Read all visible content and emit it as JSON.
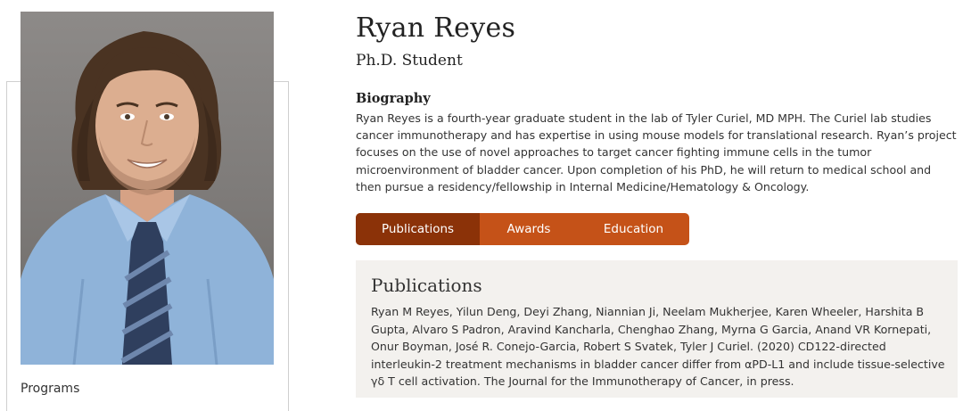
{
  "profile": {
    "name": "Ryan Reyes",
    "title": "Ph.D. Student"
  },
  "sidebar": {
    "programs_label": "Programs"
  },
  "biography": {
    "heading": "Biography",
    "text": "Ryan Reyes is a fourth-year graduate student in the lab of Tyler Curiel, MD MPH. The Curiel lab studies cancer immunotherapy and has expertise in using mouse models for translational research. Ryan’s project focuses on the use of novel approaches to target cancer fighting immune cells in the tumor microenvironment of bladder cancer. Upon completion of his PhD, he will return to medical school and then pursue a residency/fellowship in Internal Medicine/Hematology & Oncology."
  },
  "tabs": [
    {
      "label": "Publications",
      "active": true
    },
    {
      "label": "Awards",
      "active": false
    },
    {
      "label": "Education",
      "active": false
    }
  ],
  "publications": {
    "heading": "Publications",
    "entry": "Ryan M Reyes, Yilun Deng, Deyi Zhang, Niannian Ji, Neelam Mukherjee, Karen Wheeler, Harshita B Gupta, Alvaro S Padron, Aravind Kancharla, Chenghao Zhang, Myrna G Garcia, Anand VR Kornepati, Onur Boyman, José R. Conejo-Garcia, Robert S Svatek, Tyler J Curiel. (2020) CD122-directed interleukin-2 treatment mechanisms in bladder cancer differ from αPD-L1 and include tissue-selective γδ T cell activation. The Journal for the Immunotherapy of Cancer, in press."
  },
  "colors": {
    "tab_bar": "#c55218",
    "tab_active": "#8b3208",
    "panel_bg": "#f3f1ee"
  }
}
